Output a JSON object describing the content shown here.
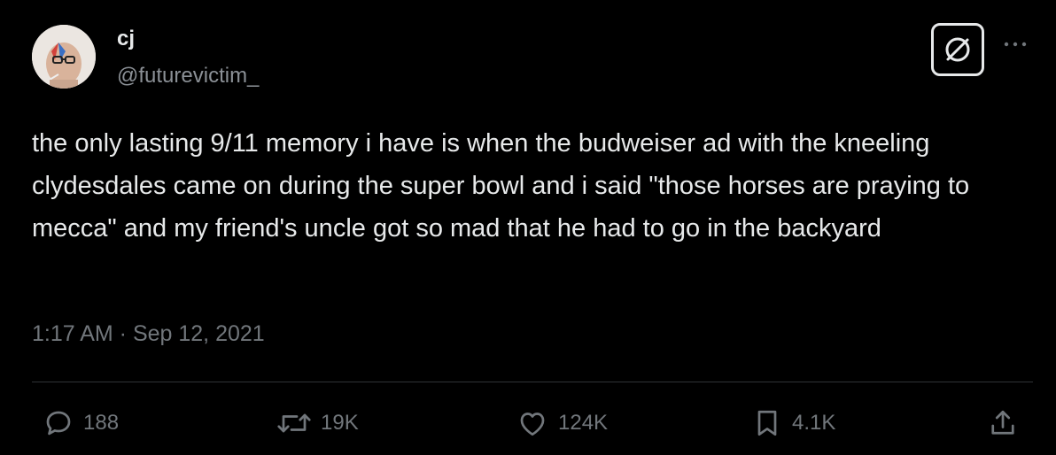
{
  "author": {
    "display_name": "cj",
    "handle": "@futurevictim_"
  },
  "tweet": {
    "text": "the only lasting 9/11 memory i have is when the budweiser ad with the kneeling clydesdales came on during the super bowl and i said \"those horses are praying to mecca\" and my friend's uncle got so mad that he had to go in the backyard",
    "timestamp": "1:17 AM · Sep 12, 2021"
  },
  "actions": {
    "replies": "188",
    "retweets": "19K",
    "likes": "124K",
    "bookmarks": "4.1K"
  },
  "icons": [
    "avatar",
    "grok-icon",
    "more-icon",
    "reply-icon",
    "retweet-icon",
    "like-icon",
    "bookmark-icon",
    "share-icon"
  ],
  "colors": {
    "background": "#000000",
    "text": "#e7e9ea",
    "secondary": "#71767b",
    "divider": "#2f3336"
  }
}
